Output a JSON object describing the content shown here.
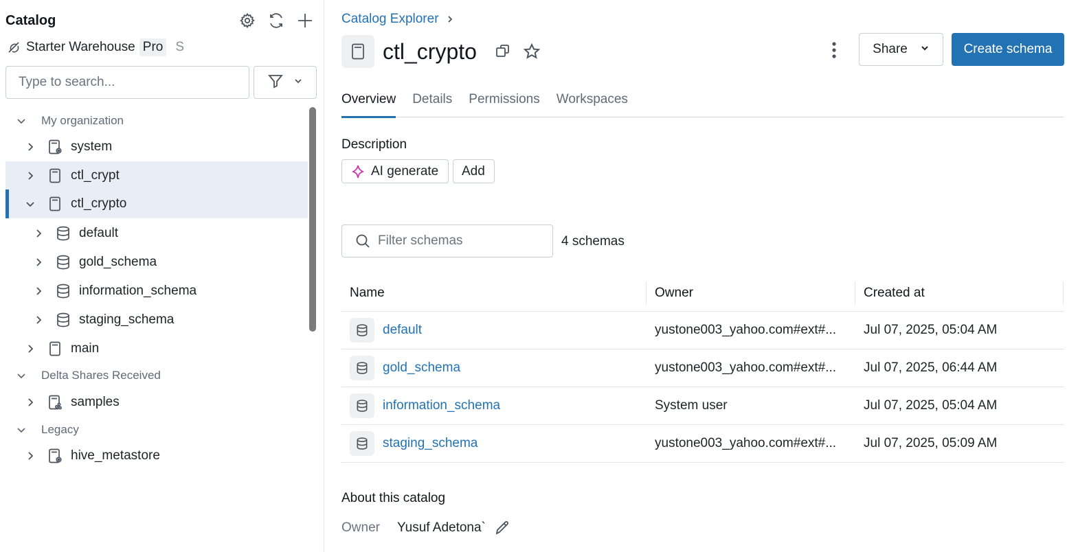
{
  "sidebar": {
    "title": "Catalog",
    "warehouse": {
      "name": "Starter Warehouse",
      "badge": "Pro",
      "extra": "S"
    },
    "search_placeholder": "Type to search...",
    "groups": [
      {
        "label": "My organization"
      },
      {
        "label": "Delta Shares Received"
      },
      {
        "label": "Legacy"
      }
    ],
    "items": [
      {
        "label": "system"
      },
      {
        "label": "ctl_crypt"
      },
      {
        "label": "ctl_crypto"
      },
      {
        "label": "default"
      },
      {
        "label": "gold_schema"
      },
      {
        "label": "information_schema"
      },
      {
        "label": "staging_schema"
      },
      {
        "label": "main"
      },
      {
        "label": "samples"
      },
      {
        "label": "hive_metastore"
      }
    ]
  },
  "main": {
    "breadcrumb": "Catalog Explorer",
    "title": "ctl_crypto",
    "share_label": "Share",
    "create_label": "Create schema",
    "tabs": [
      "Overview",
      "Details",
      "Permissions",
      "Workspaces"
    ],
    "description_label": "Description",
    "ai_generate_label": "AI generate",
    "add_label": "Add",
    "filter_placeholder": "Filter schemas",
    "schema_count": "4 schemas",
    "table": {
      "headers": [
        "Name",
        "Owner",
        "Created at"
      ],
      "rows": [
        {
          "name": "default",
          "owner": "yustone003_yahoo.com#ext#...",
          "created": "Jul 07, 2025, 05:04 AM"
        },
        {
          "name": "gold_schema",
          "owner": "yustone003_yahoo.com#ext#...",
          "created": "Jul 07, 2025, 06:44 AM"
        },
        {
          "name": "information_schema",
          "owner": "System user",
          "created": "Jul 07, 2025, 05:04 AM"
        },
        {
          "name": "staging_schema",
          "owner": "yustone003_yahoo.com#ext#...",
          "created": "Jul 07, 2025, 05:09 AM"
        }
      ]
    },
    "about_label": "About this catalog",
    "owner_label": "Owner",
    "owner_name": "Yusuf Adetona`"
  },
  "colors": {
    "accent": "#2272b4",
    "selected_bg": "#e9eef6"
  }
}
